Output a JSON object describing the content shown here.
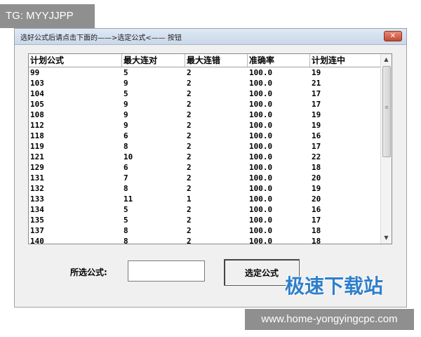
{
  "watermarks": {
    "tg": "TG: MYYJJPP",
    "brand": "极速下载站",
    "url": "www.home-yongyingcpc.com"
  },
  "window": {
    "title": "选好公式后请点击下面的——>选定公式<——  按钮",
    "close_glyph": "✕"
  },
  "table": {
    "headers": [
      "计划公式",
      "最大连对",
      "最大连错",
      "准确率",
      "计划连中"
    ],
    "rows": [
      [
        "99",
        "5",
        "2",
        "100.0",
        "19"
      ],
      [
        "103",
        "9",
        "2",
        "100.0",
        "21"
      ],
      [
        "104",
        "5",
        "2",
        "100.0",
        "17"
      ],
      [
        "105",
        "9",
        "2",
        "100.0",
        "17"
      ],
      [
        "108",
        "9",
        "2",
        "100.0",
        "19"
      ],
      [
        "112",
        "9",
        "2",
        "100.0",
        "19"
      ],
      [
        "118",
        "6",
        "2",
        "100.0",
        "16"
      ],
      [
        "119",
        "8",
        "2",
        "100.0",
        "17"
      ],
      [
        "121",
        "10",
        "2",
        "100.0",
        "22"
      ],
      [
        "129",
        "6",
        "2",
        "100.0",
        "18"
      ],
      [
        "131",
        "7",
        "2",
        "100.0",
        "20"
      ],
      [
        "132",
        "8",
        "2",
        "100.0",
        "19"
      ],
      [
        "133",
        "11",
        "1",
        "100.0",
        "20"
      ],
      [
        "134",
        "5",
        "2",
        "100.0",
        "16"
      ],
      [
        "135",
        "5",
        "2",
        "100.0",
        "17"
      ],
      [
        "137",
        "8",
        "2",
        "100.0",
        "18"
      ],
      [
        "140",
        "8",
        "2",
        "100.0",
        "18"
      ]
    ]
  },
  "scrollbar": {
    "up_glyph": "▲",
    "down_glyph": "▼",
    "grip_glyph": "≡"
  },
  "form": {
    "formula_label": "所选公式:",
    "formula_value": "",
    "select_button_label": "选定公式"
  }
}
